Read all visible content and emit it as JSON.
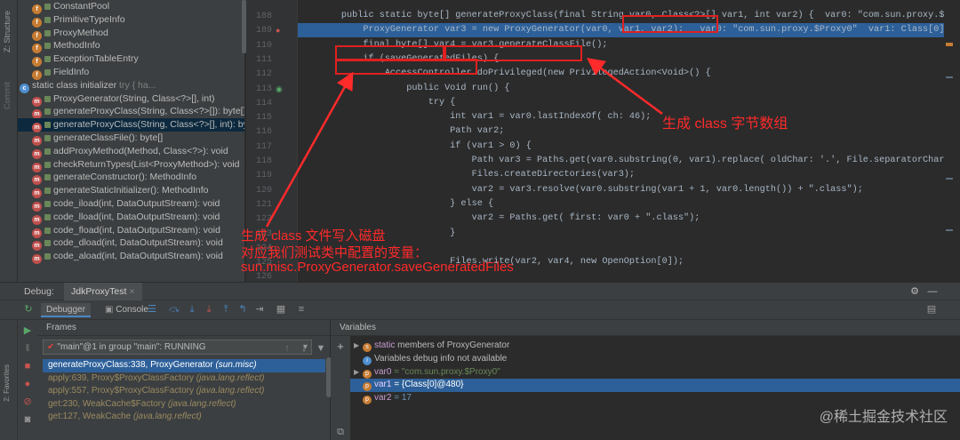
{
  "left_strip": {
    "labels": [
      "7: Structure",
      "Z: Structure"
    ]
  },
  "structure": {
    "items": [
      {
        "icon": "f",
        "label": "ConstantPool",
        "indent": 1
      },
      {
        "icon": "f",
        "label": "PrimitiveTypeInfo",
        "indent": 1
      },
      {
        "icon": "f",
        "label": "ProxyMethod",
        "indent": 1
      },
      {
        "icon": "f",
        "label": "MethodInfo",
        "indent": 1
      },
      {
        "icon": "f",
        "label": "ExceptionTableEntry",
        "indent": 1
      },
      {
        "icon": "f",
        "label": "FieldInfo",
        "indent": 1
      },
      {
        "icon": "c",
        "label": "static class initializer",
        "suffix": "try {           ha...",
        "indent": 0
      },
      {
        "icon": "m",
        "label": "ProxyGenerator(String, Class<?>[], int)",
        "indent": 1
      },
      {
        "icon": "m",
        "label": "generateProxyClass(String, Class<?>[]): byte[]",
        "indent": 1
      },
      {
        "icon": "m",
        "label": "generateProxyClass(String, Class<?>[], int): byt",
        "indent": 1,
        "selected": true
      },
      {
        "icon": "m",
        "label": "generateClassFile(): byte[]",
        "indent": 1
      },
      {
        "icon": "m",
        "label": "addProxyMethod(Method, Class<?>): void",
        "indent": 1
      },
      {
        "icon": "m",
        "label": "checkReturnTypes(List<ProxyMethod>): void",
        "indent": 1
      },
      {
        "icon": "m",
        "label": "generateConstructor(): MethodInfo",
        "indent": 1
      },
      {
        "icon": "m",
        "label": "generateStaticInitializer(): MethodInfo",
        "indent": 1
      },
      {
        "icon": "m",
        "label": "code_iload(int, DataOutputStream): void",
        "indent": 1
      },
      {
        "icon": "m",
        "label": "code_lload(int, DataOutputStream): void",
        "indent": 1
      },
      {
        "icon": "m",
        "label": "code_fload(int, DataOutputStream): void",
        "indent": 1
      },
      {
        "icon": "m",
        "label": "code_dload(int, DataOutputStream): void",
        "indent": 1
      },
      {
        "icon": "m",
        "label": "code_aload(int, DataOutputStream): void",
        "indent": 1
      }
    ]
  },
  "gutter": {
    "line_numbers": [
      "188",
      "189",
      "110",
      "111",
      "112",
      "113",
      "114",
      "115",
      "116",
      "117",
      "118",
      "119",
      "120",
      "121",
      "122",
      "123",
      "124",
      "125",
      "126"
    ]
  },
  "editor": {
    "lines": [
      {
        "t": "        public static byte[] generateProxyClass(final String var0, Class<?>[] var1, int var2) {  var0: \"com.sun.proxy.$Proxy0\"  v"
      },
      {
        "t": "            ProxyGenerator var3 = new ProxyGenerator(var0, var1, var2);   var0: \"com.sun.proxy.$Proxy0\"  var1: Class[0]@480",
        "hl": true
      },
      {
        "t": "            final byte[] var4 = var3.generateClassFile();"
      },
      {
        "t": "            if (saveGeneratedFiles) {"
      },
      {
        "t": "                AccessController.doPrivileged(new PrivilegedAction<Void>() {"
      },
      {
        "t": "                    public Void run() {"
      },
      {
        "t": "                        try {"
      },
      {
        "t": "                            int var1 = var0.lastIndexOf( ch: 46);"
      },
      {
        "t": "                            Path var2;"
      },
      {
        "t": "                            if (var1 > 0) {"
      },
      {
        "t": "                                Path var3 = Paths.get(var0.substring(0, var1).replace( oldChar: '.', File.separatorChar));"
      },
      {
        "t": "                                Files.createDirectories(var3);"
      },
      {
        "t": "                                var2 = var3.resolve(var0.substring(var1 + 1, var0.length()) + \".class\");"
      },
      {
        "t": "                            } else {"
      },
      {
        "t": "                                var2 = Paths.get( first: var0 + \".class\");"
      },
      {
        "t": "                            }"
      },
      {
        "t": ""
      },
      {
        "t": "                            Files.write(var2, var4, new OpenOption[0]);"
      },
      {
        "t": ""
      }
    ]
  },
  "annotations": {
    "class_bytes": "生成 class 字节数组",
    "write_disk_1": "生成 class 文件写入磁盘",
    "write_disk_2": "对应我们测试类中配置的变量：",
    "write_disk_3": "sun.misc.ProxyGenerator.saveGeneratedFiles"
  },
  "debug": {
    "label": "Debug:",
    "tab": "JdkProxyTest",
    "tabs": {
      "debugger": "Debugger",
      "console": "Console"
    },
    "frames_header": "Frames",
    "variables_header": "Variables",
    "thread": "\"main\"@1 in group \"main\": RUNNING",
    "frames": [
      {
        "method": "generateProxyClass:338, ProxyGenerator",
        "pkg": "(sun.misc)",
        "selected": true
      },
      {
        "method": "apply:639, Proxy$ProxyClassFactory",
        "pkg": "(java.lang.reflect)"
      },
      {
        "method": "apply:557, Proxy$ProxyClassFactory",
        "pkg": "(java.lang.reflect)"
      },
      {
        "method": "get:230, WeakCache$Factory",
        "pkg": "(java.lang.reflect)"
      },
      {
        "method": "get:127, WeakCache",
        "pkg": "(java.lang.reflect)"
      }
    ],
    "variables": [
      {
        "expand": "▶",
        "icon": "s",
        "name": "static",
        "value": " members of ProxyGenerator"
      },
      {
        "expand": "",
        "icon": "i",
        "name": "",
        "value": "Variables debug info not available"
      },
      {
        "expand": "▶",
        "icon": "p",
        "name": "var0",
        "value": " = \"com.sun.proxy.$Proxy0\"",
        "type": "str"
      },
      {
        "expand": "",
        "icon": "p",
        "name": "var1",
        "value": " = {Class[0]@480}",
        "selected": true
      },
      {
        "expand": "",
        "icon": "p",
        "name": "var2",
        "value": " = 17",
        "type": "num"
      }
    ]
  },
  "watermark": "@稀土掘金技术社区",
  "colors": {
    "highlight": "#2d6099",
    "annotation": "#ff2a2a",
    "keyword": "#cc7832"
  }
}
